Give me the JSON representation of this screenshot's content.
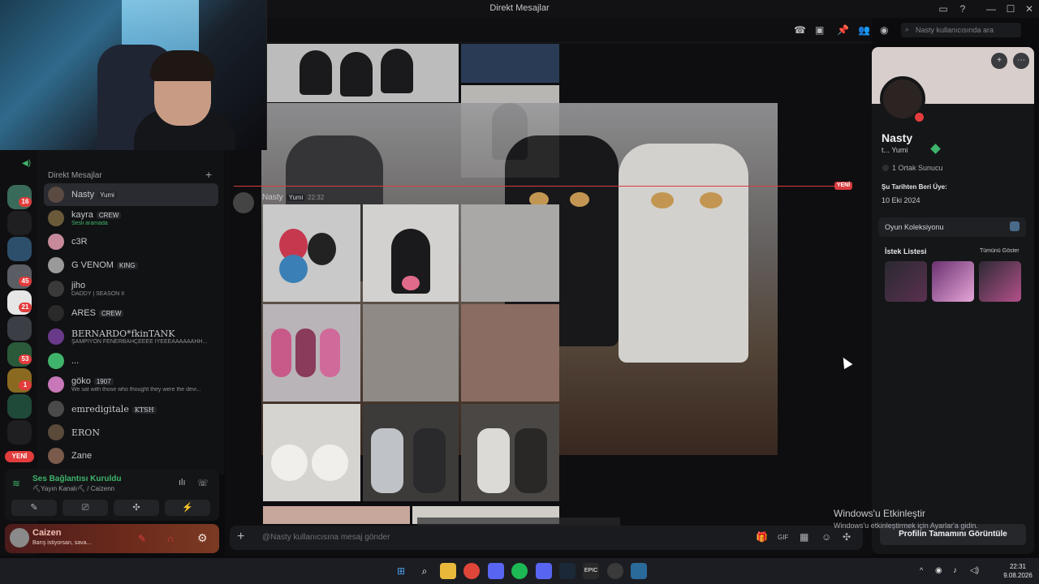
{
  "window": {
    "title": "Direkt Mesajlar",
    "controls": [
      "—",
      "☐",
      "✕"
    ]
  },
  "rail": {
    "badges": [
      "16",
      "45",
      "21",
      "53",
      "1"
    ],
    "new_label": "YENİ"
  },
  "dm_list": {
    "header": "Direkt Mesajlar",
    "plus": "+",
    "items": [
      {
        "name": "Nasty",
        "tag": "Yumi",
        "sub": ""
      },
      {
        "name": "kayra",
        "tag": "CREW",
        "sub": "Sesli aramada"
      },
      {
        "name": "c3R",
        "tag": "",
        "sub": ""
      },
      {
        "name": "G VENOM",
        "tag": "KING",
        "sub": ""
      },
      {
        "name": "jiho",
        "tag": "",
        "sub": "DADDY | SEASON II"
      },
      {
        "name": "ARES",
        "tag": "CREW",
        "sub": ""
      },
      {
        "name": "BERNARDO*fkinTANK",
        "tag": "",
        "sub": "ŞAMPİYON FENERBAHÇEEEE İYEEEAAAAAAHH..."
      },
      {
        "name": "...",
        "tag": "",
        "sub": ""
      },
      {
        "name": "göko",
        "tag": "1907",
        "sub": "We sat with those who thought they were the devi..."
      },
      {
        "name": "emredigitale",
        "tag": "KTSH",
        "sub": ""
      },
      {
        "name": "ERON",
        "tag": "",
        "sub": ""
      },
      {
        "name": "Zane",
        "tag": "",
        "sub": ""
      }
    ]
  },
  "voice": {
    "title": "Ses Bağlantısı Kuruldu",
    "sub": "⛏Yayın Kanalı⛏ / Caizenn",
    "buttons": [
      "✎",
      "⎚",
      "✣",
      "⚡"
    ]
  },
  "user": {
    "name": "Caizen",
    "status": "Barış istiyorsan, sava..."
  },
  "chat": {
    "search_placeholder": "Nasty kullanıcısında ara",
    "new_label": "YENİ",
    "author": "Nasty",
    "author_tag": "Yumi",
    "time": "22:32",
    "composer_placeholder": "@Nasty kullanıcısına mesaj gönder",
    "composer_plus": "+",
    "top_icons": [
      "☎",
      "▣",
      "📌",
      "👥",
      "◉"
    ],
    "composer_icons": [
      "🎁",
      "GIF",
      "▦",
      "☺",
      "✣"
    ]
  },
  "profile": {
    "name": "Nasty",
    "tag_line": "t...   Yumi",
    "mutual": "1 Ortak Sunucu",
    "since_label": "Şu Tarihten Beri Üye:",
    "since": "10 Eki 2024",
    "games": "Oyun Koleksiyonu",
    "wishlist": "İstek Listesi",
    "show_all": "Tümünü Göster",
    "full_profile": "Profilin Tamamını Görüntüle"
  },
  "activation": {
    "line1": "Windows'u Etkinleştir",
    "line2": "Windows'u etkinleştirmek için Ayarlar'a gidin."
  },
  "taskbar": {
    "time": "22:31",
    "date": "9.08.2026"
  },
  "colors": {
    "accent_red": "#d83c3e",
    "online_green": "#3fb36b",
    "bg": "#0e0e10"
  }
}
